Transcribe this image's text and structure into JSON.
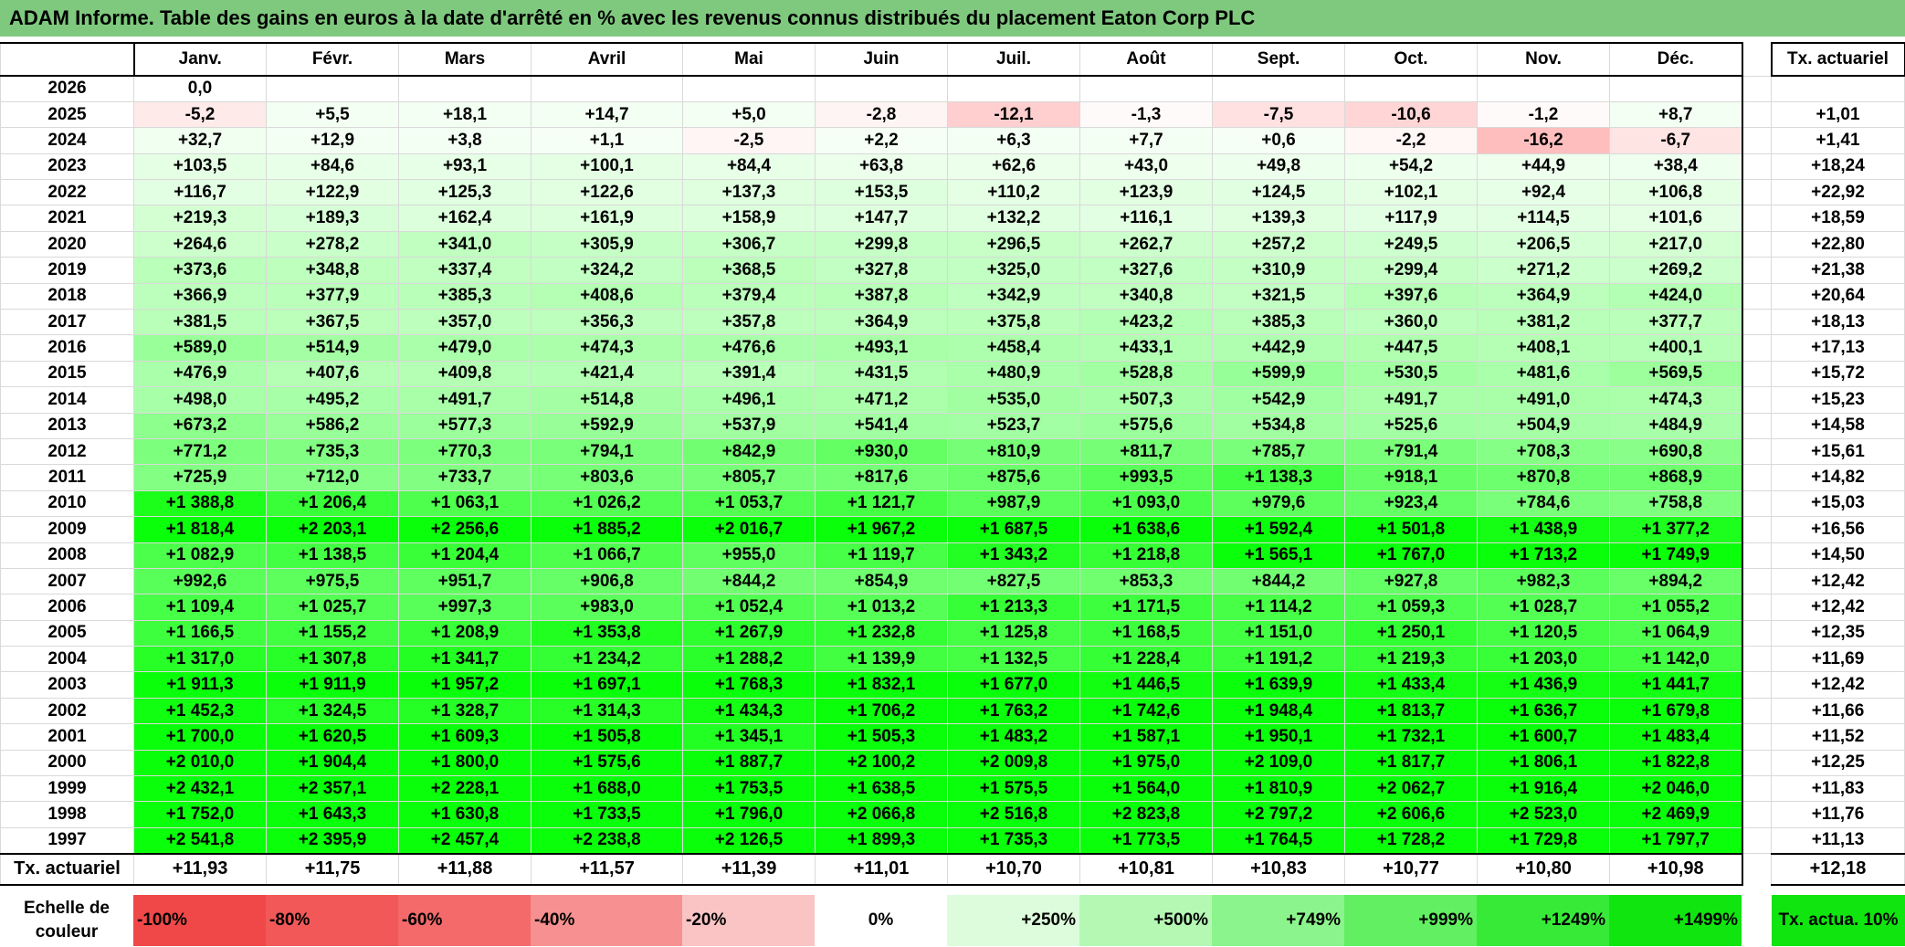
{
  "title": "ADAM Informe. Table des gains en euros à la date d'arrêté en % avec les revenus connus distribués du placement Eaton Corp PLC",
  "months": [
    "Janv.",
    "Févr.",
    "Mars",
    "Avril",
    "Mai",
    "Juin",
    "Juil.",
    "Août",
    "Sept.",
    "Oct.",
    "Nov.",
    "Déc."
  ],
  "tx_header": "Tx. actuariel",
  "rows": [
    {
      "year": "2026",
      "values": [
        "0,0",
        "",
        "",
        "",
        "",
        "",
        "",
        "",
        "",
        "",
        "",
        ""
      ],
      "tx": ""
    },
    {
      "year": "2025",
      "values": [
        "-5,2",
        "+5,5",
        "+18,1",
        "+14,7",
        "+5,0",
        "-2,8",
        "-12,1",
        "-1,3",
        "-7,5",
        "-10,6",
        "-1,2",
        "+8,7"
      ],
      "tx": "+1,01"
    },
    {
      "year": "2024",
      "values": [
        "+32,7",
        "+12,9",
        "+3,8",
        "+1,1",
        "-2,5",
        "+2,2",
        "+6,3",
        "+7,7",
        "+0,6",
        "-2,2",
        "-16,2",
        "-6,7"
      ],
      "tx": "+1,41"
    },
    {
      "year": "2023",
      "values": [
        "+103,5",
        "+84,6",
        "+93,1",
        "+100,1",
        "+84,4",
        "+63,8",
        "+62,6",
        "+43,0",
        "+49,8",
        "+54,2",
        "+44,9",
        "+38,4"
      ],
      "tx": "+18,24"
    },
    {
      "year": "2022",
      "values": [
        "+116,7",
        "+122,9",
        "+125,3",
        "+122,6",
        "+137,3",
        "+153,5",
        "+110,2",
        "+123,9",
        "+124,5",
        "+102,1",
        "+92,4",
        "+106,8"
      ],
      "tx": "+22,92"
    },
    {
      "year": "2021",
      "values": [
        "+219,3",
        "+189,3",
        "+162,4",
        "+161,9",
        "+158,9",
        "+147,7",
        "+132,2",
        "+116,1",
        "+139,3",
        "+117,9",
        "+114,5",
        "+101,6"
      ],
      "tx": "+18,59"
    },
    {
      "year": "2020",
      "values": [
        "+264,6",
        "+278,2",
        "+341,0",
        "+305,9",
        "+306,7",
        "+299,8",
        "+296,5",
        "+262,7",
        "+257,2",
        "+249,5",
        "+206,5",
        "+217,0"
      ],
      "tx": "+22,80"
    },
    {
      "year": "2019",
      "values": [
        "+373,6",
        "+348,8",
        "+337,4",
        "+324,2",
        "+368,5",
        "+327,8",
        "+325,0",
        "+327,6",
        "+310,9",
        "+299,4",
        "+271,2",
        "+269,2"
      ],
      "tx": "+21,38"
    },
    {
      "year": "2018",
      "values": [
        "+366,9",
        "+377,9",
        "+385,3",
        "+408,6",
        "+379,4",
        "+387,8",
        "+342,9",
        "+340,8",
        "+321,5",
        "+397,6",
        "+364,9",
        "+424,0"
      ],
      "tx": "+20,64"
    },
    {
      "year": "2017",
      "values": [
        "+381,5",
        "+367,5",
        "+357,0",
        "+356,3",
        "+357,8",
        "+364,9",
        "+375,8",
        "+423,2",
        "+385,3",
        "+360,0",
        "+381,2",
        "+377,7"
      ],
      "tx": "+18,13"
    },
    {
      "year": "2016",
      "values": [
        "+589,0",
        "+514,9",
        "+479,0",
        "+474,3",
        "+476,6",
        "+493,1",
        "+458,4",
        "+433,1",
        "+442,9",
        "+447,5",
        "+408,1",
        "+400,1"
      ],
      "tx": "+17,13"
    },
    {
      "year": "2015",
      "values": [
        "+476,9",
        "+407,6",
        "+409,8",
        "+421,4",
        "+391,4",
        "+431,5",
        "+480,9",
        "+528,8",
        "+599,9",
        "+530,5",
        "+481,6",
        "+569,5"
      ],
      "tx": "+15,72"
    },
    {
      "year": "2014",
      "values": [
        "+498,0",
        "+495,2",
        "+491,7",
        "+514,8",
        "+496,1",
        "+471,2",
        "+535,0",
        "+507,3",
        "+542,9",
        "+491,7",
        "+491,0",
        "+474,3"
      ],
      "tx": "+15,23"
    },
    {
      "year": "2013",
      "values": [
        "+673,2",
        "+586,2",
        "+577,3",
        "+592,9",
        "+537,9",
        "+541,4",
        "+523,7",
        "+575,6",
        "+534,8",
        "+525,6",
        "+504,9",
        "+484,9"
      ],
      "tx": "+14,58"
    },
    {
      "year": "2012",
      "values": [
        "+771,2",
        "+735,3",
        "+770,3",
        "+794,1",
        "+842,9",
        "+930,0",
        "+810,9",
        "+811,7",
        "+785,7",
        "+791,4",
        "+708,3",
        "+690,8"
      ],
      "tx": "+15,61"
    },
    {
      "year": "2011",
      "values": [
        "+725,9",
        "+712,0",
        "+733,7",
        "+803,6",
        "+805,7",
        "+817,6",
        "+875,6",
        "+993,5",
        "+1 138,3",
        "+918,1",
        "+870,8",
        "+868,9"
      ],
      "tx": "+14,82"
    },
    {
      "year": "2010",
      "values": [
        "+1 388,8",
        "+1 206,4",
        "+1 063,1",
        "+1 026,2",
        "+1 053,7",
        "+1 121,7",
        "+987,9",
        "+1 093,0",
        "+979,6",
        "+923,4",
        "+784,6",
        "+758,8"
      ],
      "tx": "+15,03"
    },
    {
      "year": "2009",
      "values": [
        "+1 818,4",
        "+2 203,1",
        "+2 256,6",
        "+1 885,2",
        "+2 016,7",
        "+1 967,2",
        "+1 687,5",
        "+1 638,6",
        "+1 592,4",
        "+1 501,8",
        "+1 438,9",
        "+1 377,2"
      ],
      "tx": "+16,56"
    },
    {
      "year": "2008",
      "values": [
        "+1 082,9",
        "+1 138,5",
        "+1 204,4",
        "+1 066,7",
        "+955,0",
        "+1 119,7",
        "+1 343,2",
        "+1 218,8",
        "+1 565,1",
        "+1 767,0",
        "+1 713,2",
        "+1 749,9"
      ],
      "tx": "+14,50"
    },
    {
      "year": "2007",
      "values": [
        "+992,6",
        "+975,5",
        "+951,7",
        "+906,8",
        "+844,2",
        "+854,9",
        "+827,5",
        "+853,3",
        "+844,2",
        "+927,8",
        "+982,3",
        "+894,2"
      ],
      "tx": "+12,42"
    },
    {
      "year": "2006",
      "values": [
        "+1 109,4",
        "+1 025,7",
        "+997,3",
        "+983,0",
        "+1 052,4",
        "+1 013,2",
        "+1 213,3",
        "+1 171,5",
        "+1 114,2",
        "+1 059,3",
        "+1 028,7",
        "+1 055,2"
      ],
      "tx": "+12,42"
    },
    {
      "year": "2005",
      "values": [
        "+1 166,5",
        "+1 155,2",
        "+1 208,9",
        "+1 353,8",
        "+1 267,9",
        "+1 232,8",
        "+1 125,8",
        "+1 168,5",
        "+1 151,0",
        "+1 250,1",
        "+1 120,5",
        "+1 064,9"
      ],
      "tx": "+12,35"
    },
    {
      "year": "2004",
      "values": [
        "+1 317,0",
        "+1 307,8",
        "+1 341,7",
        "+1 234,2",
        "+1 288,2",
        "+1 139,9",
        "+1 132,5",
        "+1 228,4",
        "+1 191,2",
        "+1 219,3",
        "+1 203,0",
        "+1 142,0"
      ],
      "tx": "+11,69"
    },
    {
      "year": "2003",
      "values": [
        "+1 911,3",
        "+1 911,9",
        "+1 957,2",
        "+1 697,1",
        "+1 768,3",
        "+1 832,1",
        "+1 677,0",
        "+1 446,5",
        "+1 639,9",
        "+1 433,4",
        "+1 436,9",
        "+1 441,7"
      ],
      "tx": "+12,42"
    },
    {
      "year": "2002",
      "values": [
        "+1 452,3",
        "+1 324,5",
        "+1 328,7",
        "+1 314,3",
        "+1 434,3",
        "+1 706,2",
        "+1 763,2",
        "+1 742,6",
        "+1 948,4",
        "+1 813,7",
        "+1 636,7",
        "+1 679,8"
      ],
      "tx": "+11,66"
    },
    {
      "year": "2001",
      "values": [
        "+1 700,0",
        "+1 620,5",
        "+1 609,3",
        "+1 505,8",
        "+1 345,1",
        "+1 505,3",
        "+1 483,2",
        "+1 587,1",
        "+1 950,1",
        "+1 732,1",
        "+1 600,7",
        "+1 483,4"
      ],
      "tx": "+11,52"
    },
    {
      "year": "2000",
      "values": [
        "+2 010,0",
        "+1 904,4",
        "+1 800,0",
        "+1 575,6",
        "+1 887,7",
        "+2 100,2",
        "+2 009,8",
        "+1 975,0",
        "+2 109,0",
        "+1 817,7",
        "+1 806,1",
        "+1 822,8"
      ],
      "tx": "+12,25"
    },
    {
      "year": "1999",
      "values": [
        "+2 432,1",
        "+2 357,1",
        "+2 228,1",
        "+1 688,0",
        "+1 753,5",
        "+1 638,5",
        "+1 575,5",
        "+1 564,0",
        "+1 810,9",
        "+2 062,7",
        "+1 916,4",
        "+2 046,0"
      ],
      "tx": "+11,83"
    },
    {
      "year": "1998",
      "values": [
        "+1 752,0",
        "+1 643,3",
        "+1 630,8",
        "+1 733,5",
        "+1 796,0",
        "+2 066,8",
        "+2 516,8",
        "+2 823,8",
        "+2 797,2",
        "+2 606,6",
        "+2 523,0",
        "+2 469,9"
      ],
      "tx": "+11,76"
    },
    {
      "year": "1997",
      "values": [
        "+2 541,8",
        "+2 395,9",
        "+2 457,4",
        "+2 238,8",
        "+2 126,5",
        "+1 899,3",
        "+1 735,3",
        "+1 773,5",
        "+1 764,5",
        "+1 728,2",
        "+1 729,8",
        "+1 797,7"
      ],
      "tx": "+11,13"
    }
  ],
  "footer": {
    "label": "Tx. actuariel",
    "values": [
      "+11,93",
      "+11,75",
      "+11,88",
      "+11,57",
      "+11,39",
      "+11,01",
      "+10,70",
      "+10,81",
      "+10,83",
      "+10,77",
      "+10,80",
      "+10,98"
    ],
    "tx": "+12,18"
  },
  "scale": {
    "label": "Echelle de couleur",
    "items": [
      {
        "text": "-100%",
        "color": "#f04848"
      },
      {
        "text": "-80%",
        "color": "#f25858"
      },
      {
        "text": "-60%",
        "color": "#f46a6a"
      },
      {
        "text": "-40%",
        "color": "#f79090"
      },
      {
        "text": "-20%",
        "color": "#fbc4c4"
      },
      {
        "text": "0%",
        "color": "#ffffff"
      },
      {
        "text": "+250%",
        "color": "#dcfcdc"
      },
      {
        "text": "+500%",
        "color": "#b4f8b4"
      },
      {
        "text": "+749%",
        "color": "#8cf48c"
      },
      {
        "text": "+999%",
        "color": "#62ef62"
      },
      {
        "text": "+1249%",
        "color": "#38ea38"
      },
      {
        "text": "+1499%",
        "color": "#10e510"
      }
    ],
    "tx_label": "Tx. actua. 10%",
    "tx_color": "#10e510"
  }
}
